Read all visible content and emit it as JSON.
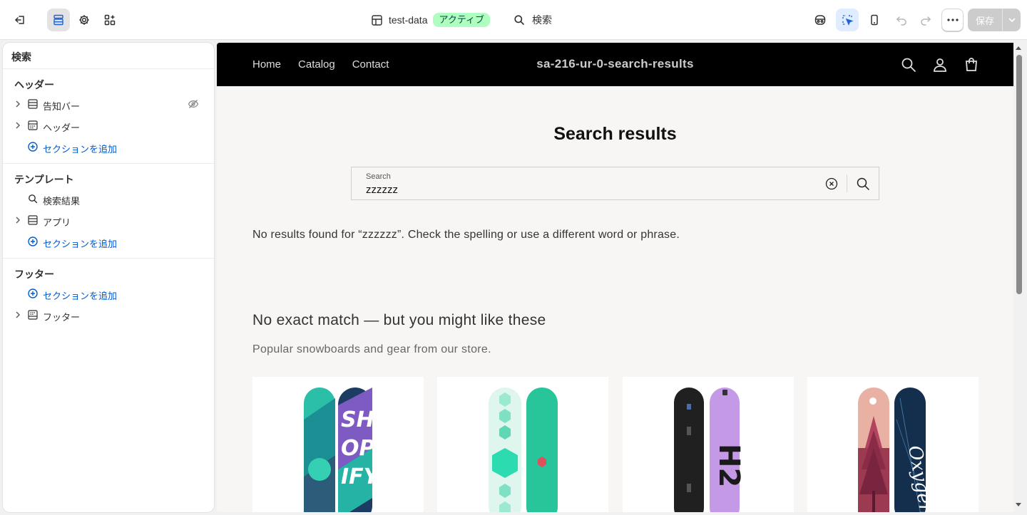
{
  "topbar": {
    "store_name": "test-data",
    "status_badge": "アクティブ",
    "search_label": "検索",
    "save_label": "保存"
  },
  "sidebar": {
    "title": "検索",
    "groups": [
      {
        "title": "ヘッダー",
        "items": [
          {
            "label": "告知バー",
            "icon": "section-icon",
            "hidden": true
          },
          {
            "label": "ヘッダー",
            "icon": "header-section-icon"
          },
          {
            "label": "セクションを追加",
            "icon": "add-circle-icon"
          }
        ]
      },
      {
        "title": "テンプレート",
        "items": [
          {
            "label": "検索結果",
            "icon": "search-icon"
          },
          {
            "label": "アプリ",
            "icon": "section-icon"
          },
          {
            "label": "セクションを追加",
            "icon": "add-circle-icon"
          }
        ]
      },
      {
        "title": "フッター",
        "items": [
          {
            "label": "セクションを追加",
            "icon": "add-circle-icon"
          },
          {
            "label": "フッター",
            "icon": "footer-section-icon"
          }
        ]
      }
    ]
  },
  "preview": {
    "nav": [
      "Home",
      "Catalog",
      "Contact"
    ],
    "store_title": "sa-216-ur-0-search-results",
    "page_heading": "Search results",
    "search_field_label": "Search",
    "search_field_value": "zzzzzz",
    "no_results_text": "No results found for “zzzzzz”. Check the spelling or use a different word or phrase.",
    "recommend_title": "No exact match — but you might like these",
    "recommend_subtitle": "Popular snowboards and gear from our store.",
    "products": [
      {
        "image": "snowboard-shopify-teal-purple"
      },
      {
        "image": "snowboard-mint-hexagon"
      },
      {
        "image": "snowboard-black-lilac-h2"
      },
      {
        "image": "snowboard-pink-oxygen"
      }
    ]
  },
  "colors": {
    "accent_link": "#005bd3",
    "active_badge_bg": "#affebf",
    "store_header_bg": "#000000",
    "save_disabled": "#cccccc"
  }
}
